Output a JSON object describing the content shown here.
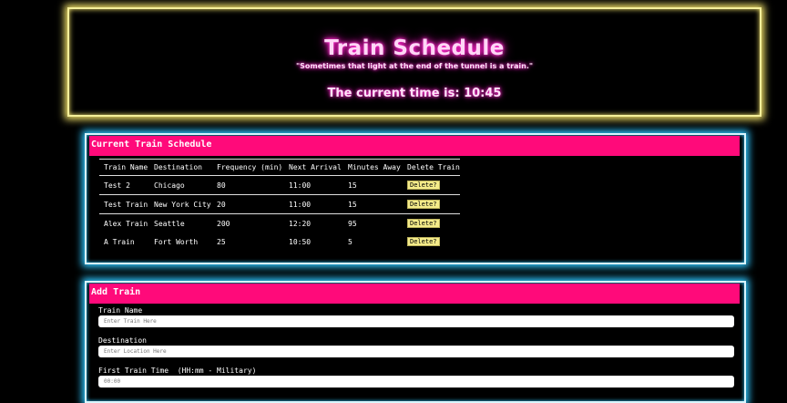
{
  "header": {
    "title": "Train Schedule",
    "quote": "\"Sometimes that light at the end of the tunnel is a train.\"",
    "current_time_text": "The current time is: 10:45"
  },
  "schedule": {
    "heading": "Current Train Schedule",
    "columns": [
      "Train Name",
      "Destination",
      "Frequency (min)",
      "Next Arrival",
      "Minutes Away",
      "Delete Train"
    ],
    "rows": [
      {
        "name": "Test 2",
        "destination": "Chicago",
        "frequency": "80",
        "next_arrival": "11:00",
        "minutes_away": "15",
        "delete": "Delete?"
      },
      {
        "name": "Test Train",
        "destination": "New York City",
        "frequency": "20",
        "next_arrival": "11:00",
        "minutes_away": "15",
        "delete": "Delete?"
      },
      {
        "name": "Alex Train",
        "destination": "Seattle",
        "frequency": "200",
        "next_arrival": "12:20",
        "minutes_away": "95",
        "delete": "Delete?"
      },
      {
        "name": "A Train",
        "destination": "Fort Worth",
        "frequency": "25",
        "next_arrival": "10:50",
        "minutes_away": "5",
        "delete": "Delete?"
      }
    ]
  },
  "add_train": {
    "heading": "Add Train",
    "fields": [
      {
        "label": "Train Name",
        "placeholder": "Enter Train Here",
        "value": ""
      },
      {
        "label": "Destination",
        "placeholder": "Enter Location Here",
        "value": ""
      },
      {
        "label": "First Train Time  (HH:mm - Military)",
        "placeholder": "00:00",
        "value": ""
      }
    ]
  },
  "colors": {
    "header_border": "#f5ef9a",
    "panel_glow": "#2ec7ff",
    "accent_pink": "#ff0a7a",
    "delete_button": "#f5ec8a"
  }
}
